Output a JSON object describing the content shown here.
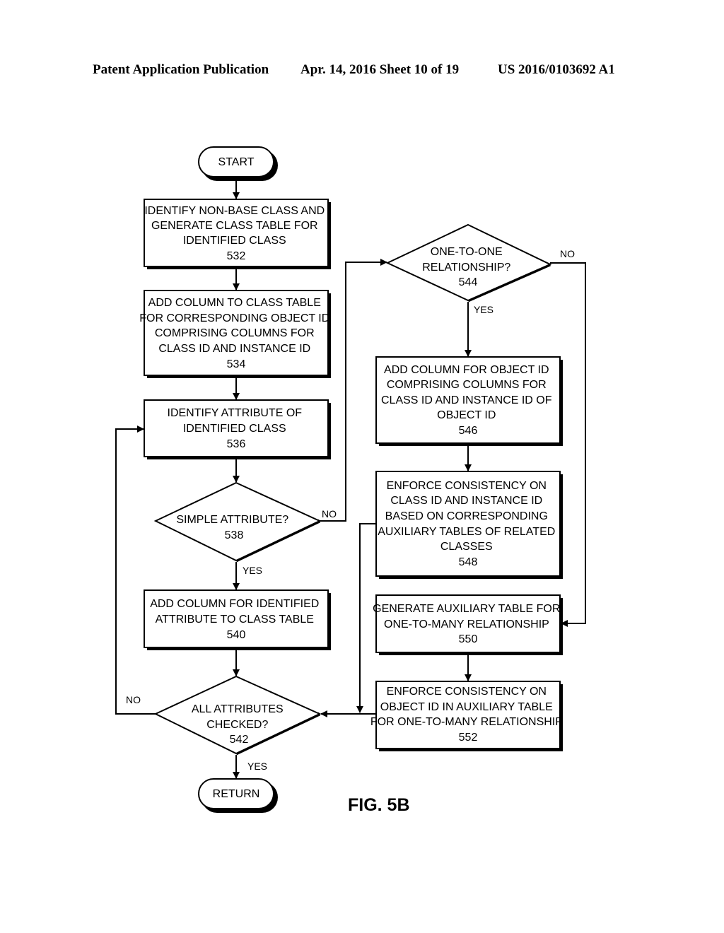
{
  "header": {
    "publication": "Patent Application Publication",
    "date_sheet": "Apr. 14, 2016  Sheet 10 of 19",
    "patent_number": "US 2016/0103692 A1"
  },
  "figure_label": "FIG. 5B",
  "nodes": {
    "start": {
      "text": "START"
    },
    "n532": {
      "lines": [
        "IDENTIFY NON-BASE CLASS AND",
        "GENERATE CLASS TABLE FOR",
        "IDENTIFIED CLASS",
        "532"
      ]
    },
    "n534": {
      "lines": [
        "ADD COLUMN TO CLASS TABLE",
        "FOR CORRESPONDING OBJECT ID",
        "COMPRISING COLUMNS FOR",
        "CLASS ID AND INSTANCE ID",
        "534"
      ]
    },
    "n536": {
      "lines": [
        "IDENTIFY ATTRIBUTE OF",
        "IDENTIFIED CLASS",
        "536"
      ]
    },
    "n538": {
      "lines": [
        "SIMPLE ATTRIBUTE?",
        "538"
      ]
    },
    "n540": {
      "lines": [
        "ADD COLUMN FOR IDENTIFIED",
        "ATTRIBUTE TO CLASS TABLE",
        "540"
      ]
    },
    "n542": {
      "lines": [
        "ALL ATTRIBUTES",
        "CHECKED?",
        "542"
      ]
    },
    "ret": {
      "text": "RETURN"
    },
    "n544": {
      "lines": [
        "ONE-TO-ONE",
        "RELATIONSHIP?",
        "544"
      ]
    },
    "n546": {
      "lines": [
        "ADD COLUMN FOR OBJECT ID",
        "COMPRISING COLUMNS FOR",
        "CLASS ID AND INSTANCE ID OF",
        "OBJECT ID",
        "546"
      ]
    },
    "n548": {
      "lines": [
        "ENFORCE CONSISTENCY ON",
        "CLASS ID AND INSTANCE ID",
        "BASED ON CORRESPONDING",
        "AUXILIARY TABLES OF RELATED",
        "CLASSES",
        "548"
      ]
    },
    "n550": {
      "lines": [
        "GENERATE AUXILIARY TABLE FOR",
        "ONE-TO-MANY RELATIONSHIP",
        "550"
      ]
    },
    "n552": {
      "lines": [
        "ENFORCE CONSISTENCY ON",
        "OBJECT ID IN AUXILIARY TABLE",
        "FOR ONE-TO-MANY RELATIONSHIP",
        "552"
      ]
    }
  },
  "edge_labels": {
    "n538_no": "NO",
    "n538_yes": "YES",
    "n542_no": "NO",
    "n542_yes": "YES",
    "n544_no": "NO",
    "n544_yes": "YES"
  }
}
